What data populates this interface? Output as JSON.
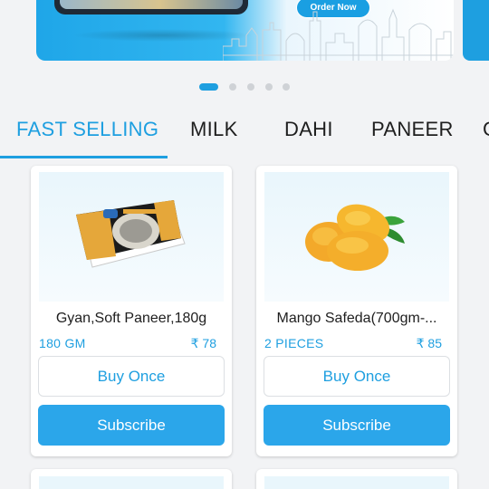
{
  "banner": {
    "order_button_label": "Order Now",
    "active_slide": 1,
    "slide_count": 5
  },
  "tabs": [
    {
      "label": "FAST SELLING",
      "active": true
    },
    {
      "label": "MILK",
      "active": false
    },
    {
      "label": "DAHI",
      "active": false
    },
    {
      "label": "PANEER",
      "active": false
    },
    {
      "label": "C",
      "active": false
    }
  ],
  "products": [
    {
      "name": "Gyan,Soft Paneer,180g",
      "quantity": "180 GM",
      "price": "₹ 78",
      "buy_once_label": "Buy Once",
      "subscribe_label": "Subscribe",
      "image": "paneer-pack-image"
    },
    {
      "name": "Mango Safeda(700gm-...",
      "quantity": "2 PIECES",
      "price": "₹ 85",
      "buy_once_label": "Buy Once",
      "subscribe_label": "Subscribe",
      "image": "mango-image"
    }
  ],
  "colors": {
    "accent": "#1e9fe0",
    "subscribe_bg": "#2ba6ea",
    "background": "#f2f3f5"
  }
}
